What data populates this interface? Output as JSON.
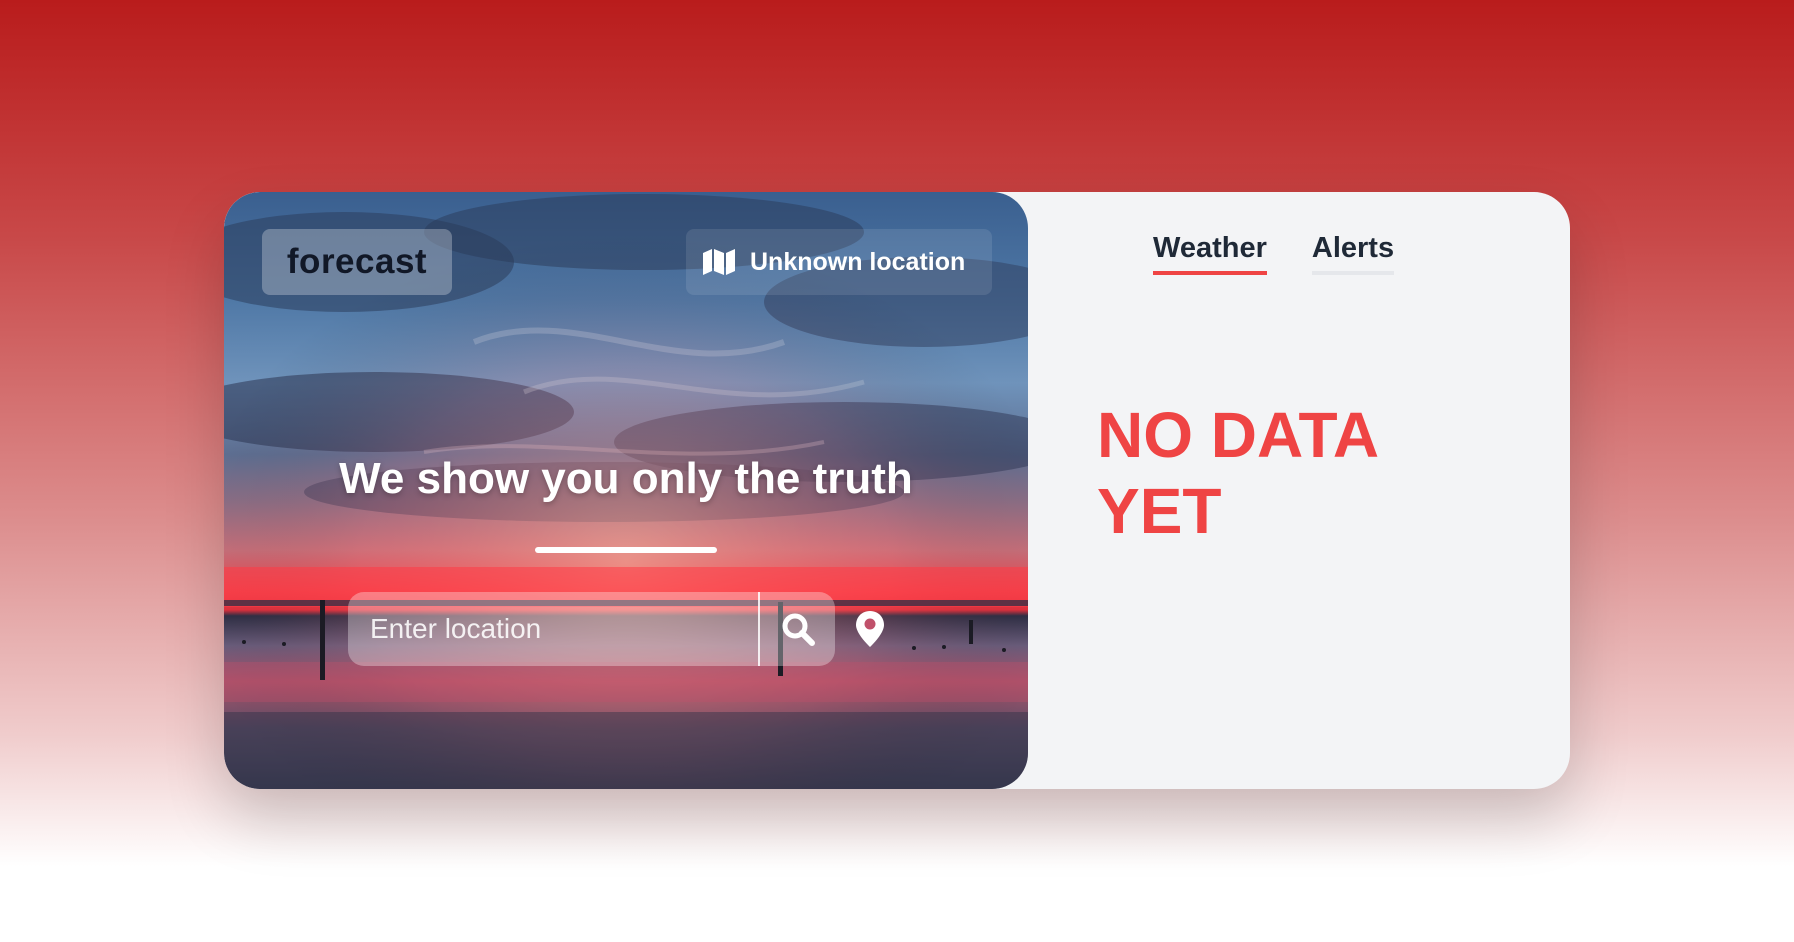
{
  "brand": {
    "logo_text": "forecast"
  },
  "location": {
    "label": "Unknown location",
    "icon": "map-icon"
  },
  "hero": {
    "headline": "We show you only the truth"
  },
  "search": {
    "placeholder": "Enter location",
    "search_icon": "search-icon",
    "geolocate_icon": "map-pin-icon"
  },
  "tabs": [
    {
      "label": "Weather",
      "active": true
    },
    {
      "label": "Alerts",
      "active": false
    }
  ],
  "status": {
    "message": "NO DATA YET"
  },
  "colors": {
    "accent": "#ef4444",
    "panel": "#f3f4f6",
    "background_top": "#b91c1c"
  }
}
